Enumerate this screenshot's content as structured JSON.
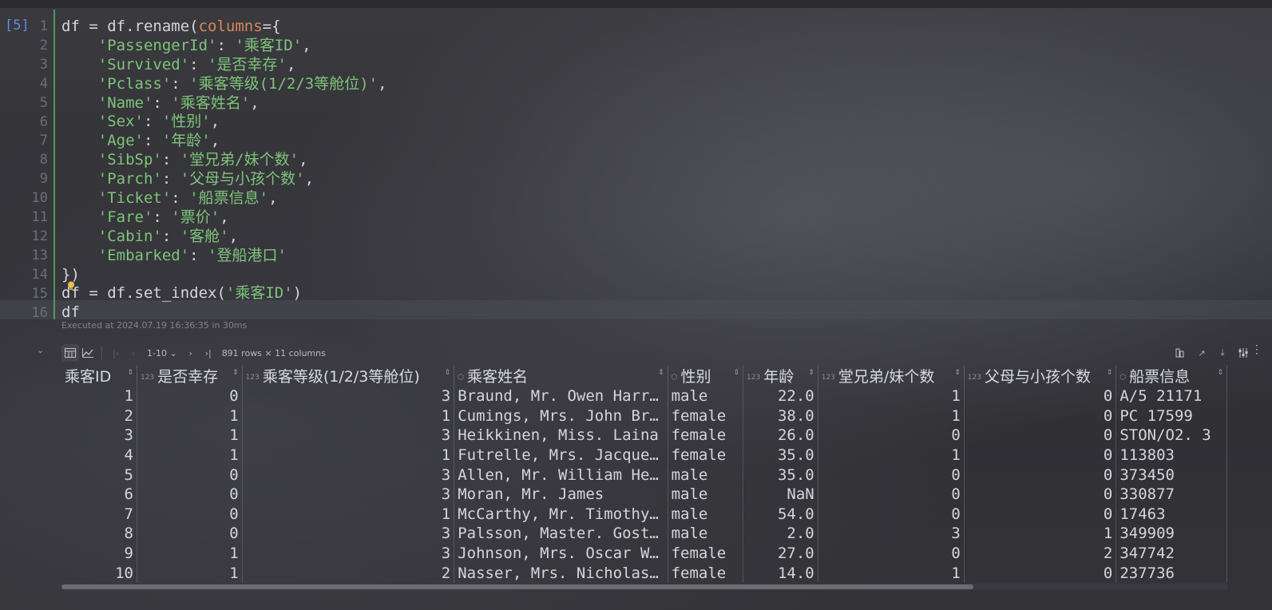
{
  "cell": {
    "exec_count": "[5]",
    "line_numbers": [
      "1",
      "2",
      "3",
      "4",
      "5",
      "6",
      "7",
      "8",
      "9",
      "10",
      "11",
      "12",
      "13",
      "14",
      "15",
      "16"
    ],
    "executed_info": "Executed at 2024.07.19 16:36:35 in 30ms"
  },
  "code_lines": [
    {
      "a": "df = df.rename(",
      "b": "columns",
      "c": "={"
    },
    {
      "a": "    ",
      "s": "'PassengerId'",
      "m": ": ",
      "t": "'乘客ID'",
      "e": ","
    },
    {
      "a": "    ",
      "s": "'Survived'",
      "m": ": ",
      "t": "'是否幸存'",
      "e": ","
    },
    {
      "a": "    ",
      "s": "'Pclass'",
      "m": ": ",
      "t": "'乘客等级(1/2/3等舱位)'",
      "e": ","
    },
    {
      "a": "    ",
      "s": "'Name'",
      "m": ": ",
      "t": "'乘客姓名'",
      "e": ","
    },
    {
      "a": "    ",
      "s": "'Sex'",
      "m": ": ",
      "t": "'性别'",
      "e": ","
    },
    {
      "a": "    ",
      "s": "'Age'",
      "m": ": ",
      "t": "'年龄'",
      "e": ","
    },
    {
      "a": "    ",
      "s": "'SibSp'",
      "m": ": ",
      "t": "'堂兄弟/妹个数'",
      "e": ","
    },
    {
      "a": "    ",
      "s": "'Parch'",
      "m": ": ",
      "t": "'父母与小孩个数'",
      "e": ","
    },
    {
      "a": "    ",
      "s": "'Ticket'",
      "m": ": ",
      "t": "'船票信息'",
      "e": ","
    },
    {
      "a": "    ",
      "s": "'Fare'",
      "m": ": ",
      "t": "'票价'",
      "e": ","
    },
    {
      "a": "    ",
      "s": "'Cabin'",
      "m": ": ",
      "t": "'客舱'",
      "e": ","
    },
    {
      "a": "    ",
      "s": "'Embarked'",
      "m": ": ",
      "t": "'登船港口'",
      "e": ""
    },
    {
      "a": "})"
    },
    {
      "a": "df = df.set_index(",
      "t": "'乘客ID'",
      "e": ")"
    },
    {
      "a": "df"
    }
  ],
  "toolbar": {
    "page_range": "1-10",
    "row_info": "891 rows × 11 columns"
  },
  "table": {
    "columns": [
      {
        "label": "乘客ID",
        "type": ""
      },
      {
        "label": "是否幸存",
        "type": "123"
      },
      {
        "label": "乘客等级(1/2/3等舱位)",
        "type": "123"
      },
      {
        "label": "乘客姓名",
        "type": "abc"
      },
      {
        "label": "性别",
        "type": "abc"
      },
      {
        "label": "年龄",
        "type": "123"
      },
      {
        "label": "堂兄弟/妹个数",
        "type": "123"
      },
      {
        "label": "父母与小孩个数",
        "type": "123"
      },
      {
        "label": "船票信息",
        "type": "abc"
      }
    ],
    "rows": [
      [
        "1",
        "0",
        "3",
        "Braund, Mr. Owen Harr…",
        "male",
        "22.0",
        "1",
        "0",
        "A/5 21171"
      ],
      [
        "2",
        "1",
        "1",
        "Cumings, Mrs. John Br…",
        "female",
        "38.0",
        "1",
        "0",
        "PC 17599"
      ],
      [
        "3",
        "1",
        "3",
        "Heikkinen, Miss. Laina",
        "female",
        "26.0",
        "0",
        "0",
        "STON/O2. 3"
      ],
      [
        "4",
        "1",
        "1",
        "Futrelle, Mrs. Jacque…",
        "female",
        "35.0",
        "1",
        "0",
        "113803"
      ],
      [
        "5",
        "0",
        "3",
        "Allen, Mr. William He…",
        "male",
        "35.0",
        "0",
        "0",
        "373450"
      ],
      [
        "6",
        "0",
        "3",
        "Moran, Mr. James",
        "male",
        "NaN",
        "0",
        "0",
        "330877"
      ],
      [
        "7",
        "0",
        "1",
        "McCarthy, Mr. Timothy…",
        "male",
        "54.0",
        "0",
        "0",
        "17463"
      ],
      [
        "8",
        "0",
        "3",
        "Palsson, Master. Gost…",
        "male",
        "2.0",
        "3",
        "1",
        "349909"
      ],
      [
        "9",
        "1",
        "3",
        "Johnson, Mrs. Oscar W…",
        "female",
        "27.0",
        "0",
        "2",
        "347742"
      ],
      [
        "10",
        "1",
        "2",
        "Nasser, Mrs. Nicholas…",
        "female",
        "14.0",
        "1",
        "0",
        "237736"
      ]
    ]
  }
}
